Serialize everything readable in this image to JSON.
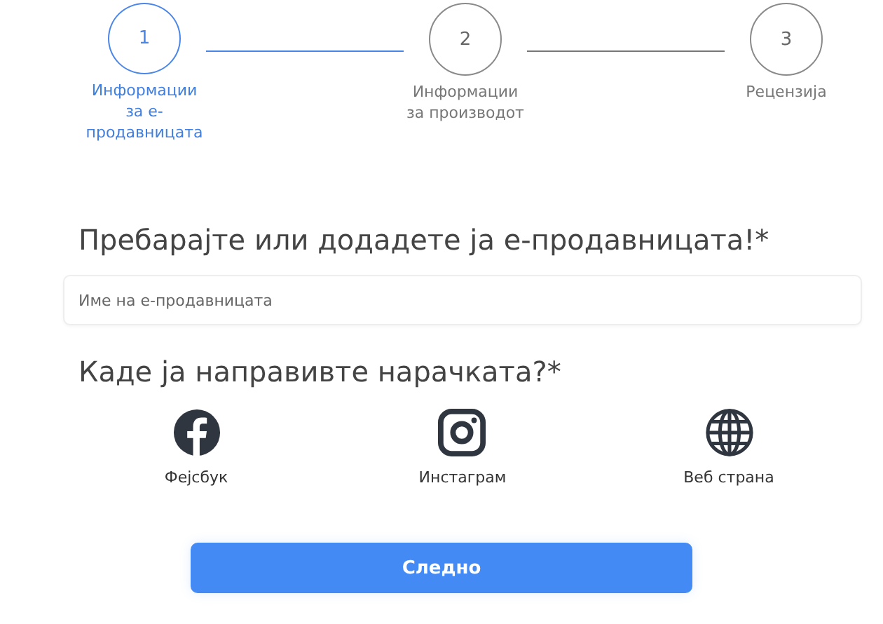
{
  "steps": [
    {
      "number": "1",
      "label": "Информации за е-продавницата",
      "selected": true
    },
    {
      "number": "2",
      "label": "Информации за производот",
      "selected": false
    },
    {
      "number": "3",
      "label": "Рецензија",
      "selected": false
    }
  ],
  "store_section": {
    "heading": "Пребарајте или додадете ја е-продавницата!*",
    "search": {
      "placeholder": "Име на е-продавницата"
    }
  },
  "order_section": {
    "heading": "Каде ја направивте нарачката?*",
    "options": [
      {
        "kind": "facebook",
        "label": "Фејсбук"
      },
      {
        "kind": "instagram",
        "label": "Инстаграм"
      },
      {
        "kind": "web",
        "label": "Веб страна"
      }
    ]
  },
  "next_button": "Следно"
}
